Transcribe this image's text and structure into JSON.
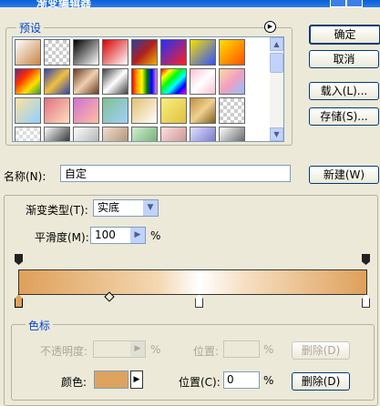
{
  "window": {
    "title": "渐变编辑器"
  },
  "presets": {
    "legend": "预设",
    "swatches": [
      "linear-gradient(135deg,#ffffff,#c88646)",
      "repeating-conic-gradient(#ccc 0 25%,#fff 0 50%) 0 0/8px 8px",
      "linear-gradient(135deg,#000000,#ffffff)",
      "linear-gradient(135deg,#d80000,#ffffff)",
      "linear-gradient(135deg,#2a3fa0,#b02020,#f0b000)",
      "linear-gradient(135deg,#2030ff,#ff2020)",
      "linear-gradient(135deg,#f7e000,#3050ff)",
      "linear-gradient(135deg,#ffe000,#ff5000)",
      "linear-gradient(135deg,#702080,#ff3000,#ffe000,#30a030)",
      "linear-gradient(135deg,#3040b0,#f0c040,#3040b0)",
      "linear-gradient(135deg,#6b3b20,#f0d0b0,#6b3b20)",
      "linear-gradient(135deg,#404040,#ffffff,#404040)",
      "linear-gradient(90deg,red,orange,yellow,green,blue,violet)",
      "linear-gradient(135deg,red,yellow,lime,cyan,blue,magenta)",
      "linear-gradient(135deg,#f8c0d0,#ffffff,#f8c0d0)",
      "linear-gradient(135deg,#ffd8a0,#f0a0c0,#90c0ff)",
      "linear-gradient(135deg,#ffe0a0,#90d0ff)",
      "linear-gradient(135deg,#e07080,#ffe0c0)",
      "linear-gradient(135deg,#d070d0,#ffc0a0)",
      "linear-gradient(135deg,#80c090,#a0d0ff)",
      "linear-gradient(135deg,#e0c070,#ffffff)",
      "linear-gradient(135deg,#f8f080,#e0c040)",
      "linear-gradient(135deg,#c09040,#f0d090,#806020)",
      "repeating-conic-gradient(#ccc 0 25%,#fff 0 50%) 0 0/8px 8px",
      "repeating-conic-gradient(#ddd 0 25%,#fff 0 50%) 0 0/8px 8px",
      "linear-gradient(135deg,#ffffff,#000000)",
      "linear-gradient(135deg,#ffffff,#a0a0a0)",
      "linear-gradient(135deg,#f0e0d0,#a08060)",
      "linear-gradient(135deg,#d0f0d0,#60a060)",
      "linear-gradient(135deg,#ffe0e0,#c08080)",
      "linear-gradient(135deg,#e0e0ff,#6060c0)",
      "linear-gradient(135deg,#ffffff,#404040)"
    ]
  },
  "buttons": {
    "ok": "确定",
    "cancel": "取消",
    "load": "载入(L)...",
    "save": "存储(S)...",
    "new": "新建(W)",
    "delete_opacity": "删除(D)",
    "delete_color": "删除(D)"
  },
  "name": {
    "label": "名称(N):",
    "value": "自定"
  },
  "gradient": {
    "type_label": "渐变类型(T):",
    "type_value": "实底",
    "smooth_label": "平滑度(M):",
    "smooth_value": "100",
    "smooth_unit": "%"
  },
  "stops": {
    "legend": "色标",
    "opacity_label": "不透明度:",
    "opacity_unit": "%",
    "location_label": "位置:",
    "location_unit": "%",
    "color_label": "颜色:",
    "color_location_label": "位置(C):",
    "color_location_value": "0",
    "color_location_unit": "%",
    "color_value": "#dea35e",
    "color_stops": [
      {
        "location": 0,
        "color": "#dea35e",
        "selected": true
      },
      {
        "location": 52,
        "color": "#ffffff",
        "selected": false
      },
      {
        "location": 100,
        "color": "#dea35e",
        "selected": false
      }
    ],
    "opacity_stops": [
      0,
      100
    ],
    "midpoint": 26
  }
}
